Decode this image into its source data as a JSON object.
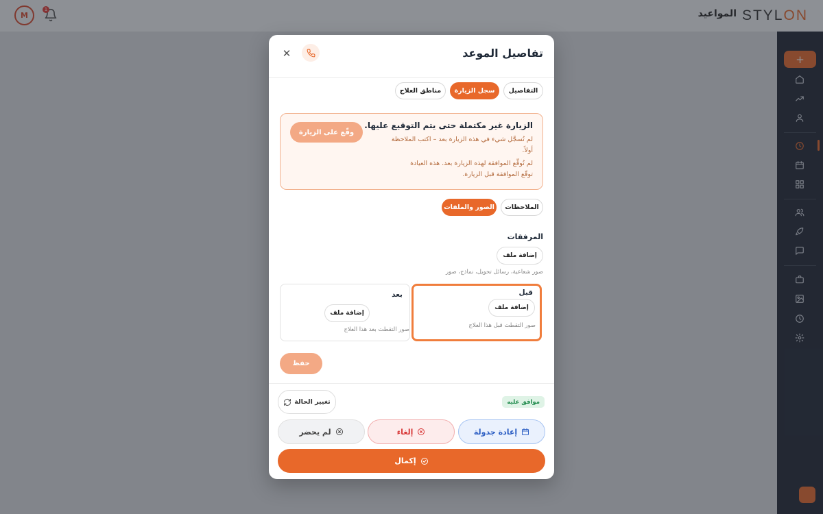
{
  "app": {
    "brand_main": "STYL",
    "brand_accent": "ON",
    "nav_title": "المواعيد",
    "avatar_initial": "M",
    "notif_count": "1"
  },
  "modal": {
    "title": "تفاصيل الموعد",
    "close_symbol": "✕",
    "tabs": [
      {
        "label": "التفاصيل",
        "active": false
      },
      {
        "label": "سجل الزيارة",
        "active": true
      },
      {
        "label": "مناطق العلاج",
        "active": false
      }
    ],
    "warning": {
      "title": "الزيارة غير مكتملة حتى يتم التوقيع عليها.",
      "line1": "لم تُسجَّل شيء في هذه الزيارة بعد – اكتب الملاحظة",
      "line2": "أولاً.",
      "line3": "لم تُوقِّع الموافقة لهذه الزيارة بعد. هذه العيادة",
      "line4": "توقّع الموافقة قبل الزيارة.",
      "sign_button": "وقّع على الزيارة"
    },
    "subtabs": [
      {
        "label": "الملاحظات",
        "active": false
      },
      {
        "label": "الصور والملفات",
        "active": true
      }
    ],
    "attachments": {
      "title": "المرفقات",
      "add_file": "إضافة ملف",
      "hint": "صور شعاعية، رسائل تحويل، نماذج، صور"
    },
    "before": {
      "label": "قبل",
      "add_file": "إضافة ملف",
      "hint": "صور التقطت قبل هذا العلاج"
    },
    "after": {
      "label": "بعد",
      "add_file": "إضافة ملف",
      "hint": "صور التقطت بعد هذا العلاج"
    },
    "save_label": "حفظ",
    "status_badge": "موافق عليه",
    "change_status": "تغيير الحالة",
    "actions": {
      "reschedule": "إعادة جدولة",
      "cancel": "إلغاء",
      "no_show": "لم يحضر",
      "complete": "إكمال"
    }
  },
  "colors": {
    "accent": "#e8682a",
    "sidebar": "#1e2533",
    "approved": "#1f8a4c",
    "reschedule": "#2d5fc4",
    "cancel": "#d83a3a"
  }
}
